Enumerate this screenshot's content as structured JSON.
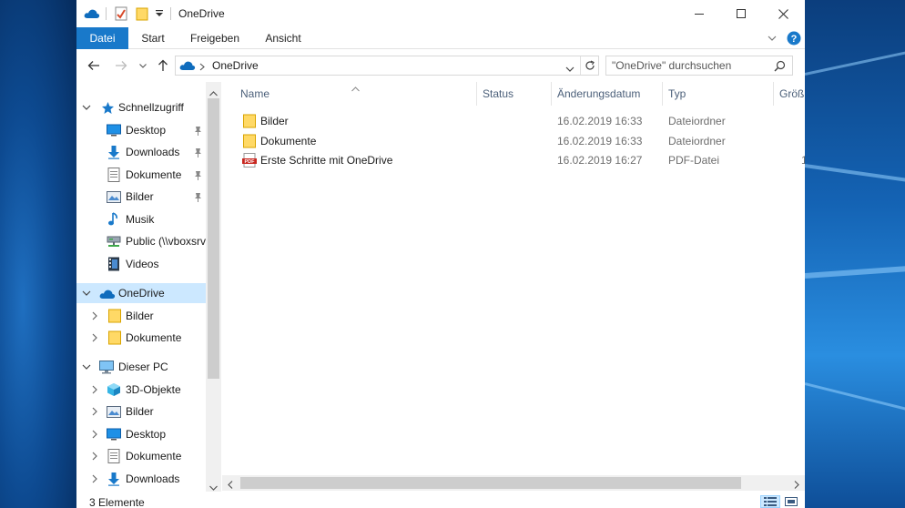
{
  "window": {
    "title": "OneDrive",
    "controls": {
      "minimize": "—",
      "maximize": "☐",
      "close": "✕"
    }
  },
  "ribbon": {
    "tabs": [
      "Datei",
      "Start",
      "Freigeben",
      "Ansicht"
    ],
    "expand_icon": "chevron-down-icon",
    "help_icon": "help-icon"
  },
  "navigation": {
    "path_label": "OneDrive",
    "search_placeholder": "\"OneDrive\" durchsuchen"
  },
  "tree": {
    "quick_access": {
      "label": "Schnellzugriff",
      "items": [
        {
          "label": "Desktop",
          "icon": "desktop-icon",
          "pinned": true
        },
        {
          "label": "Downloads",
          "icon": "downloads-icon",
          "pinned": true
        },
        {
          "label": "Dokumente",
          "icon": "documents-icon",
          "pinned": true
        },
        {
          "label": "Bilder",
          "icon": "pictures-icon",
          "pinned": true
        },
        {
          "label": "Musik",
          "icon": "music-icon",
          "pinned": false
        },
        {
          "label": "Public (\\\\vboxsrv",
          "icon": "network-drive-icon",
          "pinned": false
        },
        {
          "label": "Videos",
          "icon": "videos-icon",
          "pinned": false
        }
      ]
    },
    "onedrive": {
      "label": "OneDrive",
      "items": [
        {
          "label": "Bilder",
          "icon": "folder-icon"
        },
        {
          "label": "Dokumente",
          "icon": "folder-icon"
        }
      ]
    },
    "this_pc": {
      "label": "Dieser PC",
      "items": [
        {
          "label": "3D-Objekte",
          "icon": "3d-objects-icon"
        },
        {
          "label": "Bilder",
          "icon": "pictures-icon"
        },
        {
          "label": "Desktop",
          "icon": "desktop-icon"
        },
        {
          "label": "Dokumente",
          "icon": "documents-icon"
        },
        {
          "label": "Downloads",
          "icon": "downloads-icon"
        }
      ]
    }
  },
  "file_list": {
    "columns": [
      "Name",
      "Status",
      "Änderungsdatum",
      "Typ",
      "Größ"
    ],
    "rows": [
      {
        "name": "Bilder",
        "status": "",
        "modified": "16.02.2019 16:33",
        "type": "Dateiordner",
        "size": "",
        "icon": "folder-icon"
      },
      {
        "name": "Dokumente",
        "status": "",
        "modified": "16.02.2019 16:33",
        "type": "Dateiordner",
        "size": "",
        "icon": "folder-icon"
      },
      {
        "name": "Erste Schritte mit OneDrive",
        "status": "",
        "modified": "16.02.2019 16:27",
        "type": "PDF-Datei",
        "size": "1",
        "icon": "pdf-file-icon"
      }
    ]
  },
  "status_bar": {
    "item_count": "3 Elemente"
  },
  "colors": {
    "accent": "#1979ca",
    "selection": "#cce8ff",
    "folder": "#ffd966",
    "onedrive": "#0f6cbd",
    "header_text": "#4c607a"
  }
}
